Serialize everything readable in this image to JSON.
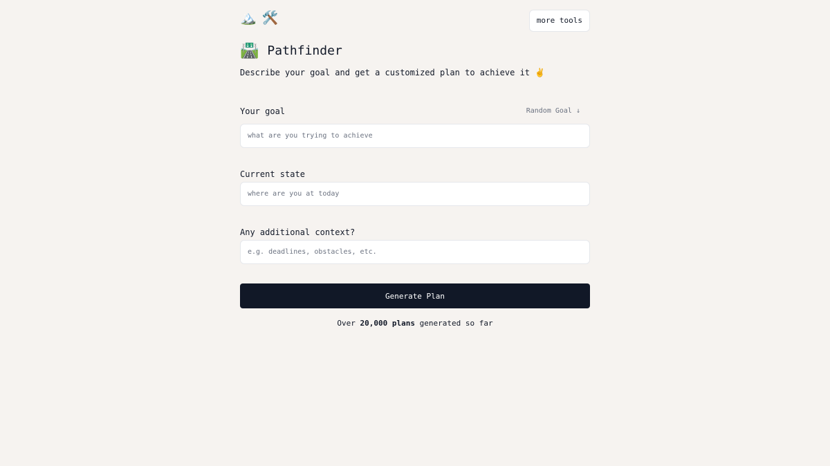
{
  "header": {
    "logo_icons": [
      "🏔️",
      "🛠️"
    ],
    "more_tools_label": "more tools"
  },
  "hero": {
    "title_icon": "🛣️",
    "title": "Pathfinder",
    "subtitle": "Describe your goal and get a customized plan to achieve it ✌️"
  },
  "form": {
    "goal": {
      "label": "Your goal",
      "random_label": "Random Goal ↓",
      "placeholder": "what are you trying to achieve",
      "value": ""
    },
    "current": {
      "label": "Current state",
      "placeholder": "where are you at today",
      "value": ""
    },
    "context": {
      "label": "Any additional context?",
      "placeholder": "e.g. deadlines, obstacles, etc.",
      "value": ""
    },
    "submit_label": "Generate Plan"
  },
  "stats": {
    "prefix": "Over ",
    "count": "20,000 plans",
    "suffix": " generated so far"
  },
  "colors": {
    "background": "#f6f3f0",
    "button": "#111827",
    "muted": "#6b7280"
  }
}
